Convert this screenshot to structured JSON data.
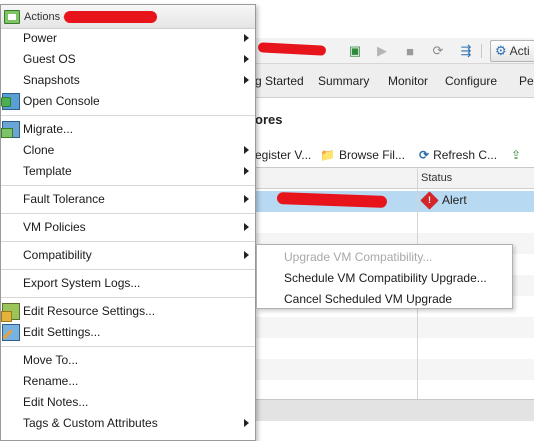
{
  "menu": {
    "title": "Actions - ",
    "items": [
      {
        "label": "Power",
        "submenu": true,
        "icon": ""
      },
      {
        "label": "Guest OS",
        "submenu": true,
        "icon": ""
      },
      {
        "label": "Snapshots",
        "submenu": true,
        "icon": ""
      },
      {
        "label": "Open Console",
        "submenu": false,
        "icon": "console-icon"
      },
      {
        "label": "Migrate...",
        "submenu": false,
        "icon": "migrate-icon"
      },
      {
        "label": "Clone",
        "submenu": true,
        "icon": ""
      },
      {
        "label": "Template",
        "submenu": true,
        "icon": ""
      },
      {
        "label": "Fault Tolerance",
        "submenu": true,
        "icon": ""
      },
      {
        "label": "VM Policies",
        "submenu": true,
        "icon": ""
      },
      {
        "label": "Compatibility",
        "submenu": true,
        "icon": ""
      },
      {
        "label": "Export System Logs...",
        "submenu": false,
        "icon": ""
      },
      {
        "label": "Edit Resource Settings...",
        "submenu": false,
        "icon": "resource-settings-icon"
      },
      {
        "label": "Edit Settings...",
        "submenu": false,
        "icon": "edit-settings-icon"
      },
      {
        "label": "Move To...",
        "submenu": false,
        "icon": ""
      },
      {
        "label": "Rename...",
        "submenu": false,
        "icon": ""
      },
      {
        "label": "Edit Notes...",
        "submenu": false,
        "icon": ""
      },
      {
        "label": "Tags & Custom Attributes",
        "submenu": true,
        "icon": ""
      }
    ]
  },
  "submenu": {
    "items": [
      {
        "label": "Upgrade VM Compatibility...",
        "disabled": true
      },
      {
        "label": "Schedule VM Compatibility Upgrade...",
        "disabled": false
      },
      {
        "label": "Cancel Scheduled VM Upgrade",
        "disabled": false
      }
    ]
  },
  "background": {
    "actions_button": "Acti",
    "tabs": [
      "g Started",
      "Summary",
      "Monitor",
      "Configure",
      "Per"
    ],
    "section_title": "ores",
    "commands": [
      "egister V...",
      "Browse Fil...",
      "Refresh C..."
    ],
    "grid": {
      "status_header": "Status",
      "status_value": "Alert"
    }
  },
  "colors": {
    "selection": "#b7d9f2",
    "alert": "#d4252b",
    "redaction": "#e8141b"
  }
}
